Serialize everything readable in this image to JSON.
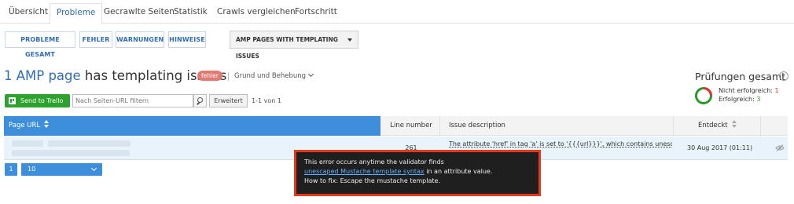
{
  "tabs": [
    {
      "label": "Übersicht",
      "active": false
    },
    {
      "label": "Probleme",
      "active": true
    },
    {
      "label": "Gecrawlte Seiten",
      "active": false
    },
    {
      "label": "Statistik",
      "active": false
    },
    {
      "label": "Crawls vergleichen",
      "active": false
    },
    {
      "label": "Fortschritt",
      "active": false
    }
  ],
  "filters": {
    "all": "PROBLEME GESAMT",
    "errors": "FEHLER",
    "warnings": "WARNUNGEN",
    "hints": "HINWEISE",
    "dropdown": "AMP PAGES WITH TEMPLATING ISSUES"
  },
  "heading": {
    "link": "1 AMP page",
    "text": " has templating issues",
    "badge": "fehler",
    "reasons": "Grund und Behebung"
  },
  "toolbar": {
    "trello": "Send to Trello",
    "search_placeholder": "Nach Seiten-URL filtern",
    "advanced": "Erweitert",
    "count": "1-1 von 1"
  },
  "checks": {
    "title": "Prüfungen gesamt",
    "failed_label": "Nicht erfolgreich: ",
    "failed": "1",
    "passed_label": "Erfolgreich: ",
    "passed": "3",
    "colors": {
      "failed": "#dd3333",
      "passed": "#2b9a2b"
    }
  },
  "table": {
    "headers": {
      "url": "Page URL",
      "line": "Line number",
      "desc": "Issue description",
      "found": "Entdeckt"
    },
    "rows": [
      {
        "line": "261",
        "desc": "The attribute 'href' in tag 'a' is set to '{{{url}}}', which contains unescaped",
        "date": "30 Aug 2017 (01:11)"
      }
    ]
  },
  "pagination": {
    "page": "1",
    "per_page": "10"
  },
  "tooltip": {
    "line1": "This error occurs anytime the validator finds",
    "link": "unescaped Mustache template syntax",
    "line2_rest": " in an attribute value.",
    "line3": "How to fix: Escape the mustache template."
  },
  "accent": "#3d8fdb"
}
